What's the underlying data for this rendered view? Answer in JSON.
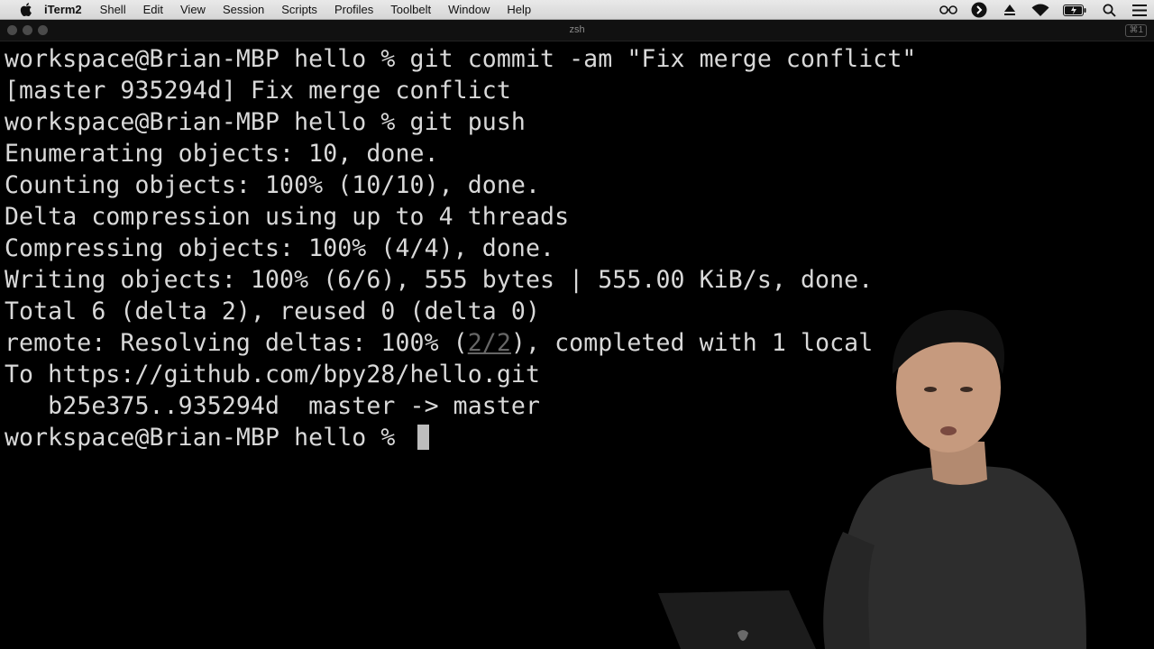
{
  "menubar": {
    "app_name": "iTerm2",
    "items": [
      "Shell",
      "Edit",
      "View",
      "Session",
      "Scripts",
      "Profiles",
      "Toolbelt",
      "Window",
      "Help"
    ],
    "tray_icons": [
      "glasses-icon",
      "circle-arrow-icon",
      "upload-icon",
      "wifi-icon",
      "battery-icon",
      "search-icon",
      "menu-list-icon"
    ]
  },
  "window": {
    "title": "zsh",
    "shortcut": "⌘1"
  },
  "terminal": {
    "lines": [
      {
        "text": "workspace@Brian-MBP hello % git commit -am \"Fix merge conflict\""
      },
      {
        "text": "[master 935294d] Fix merge conflict"
      },
      {
        "text": "workspace@Brian-MBP hello % git push"
      },
      {
        "text": "Enumerating objects: 10, done."
      },
      {
        "text": "Counting objects: 100% (10/10), done."
      },
      {
        "text": "Delta compression using up to 4 threads"
      },
      {
        "text": "Compressing objects: 100% (4/4), done."
      },
      {
        "text": "Writing objects: 100% (6/6), 555 bytes | 555.00 KiB/s, done."
      },
      {
        "text": "Total 6 (delta 2), reused 0 (delta 0)"
      },
      {
        "pre": "remote: Resolving deltas: 100% (",
        "dim": "2/2",
        "post": "), completed with 1 local"
      },
      {
        "text": "To https://github.com/bpy28/hello.git"
      },
      {
        "text": "   b25e375..935294d  master -> master"
      },
      {
        "text": "workspace@Brian-MBP hello % "
      }
    ]
  },
  "colors": {
    "background": "#000000",
    "text": "#d9d9d9",
    "cursor": "#bdbdbd"
  }
}
